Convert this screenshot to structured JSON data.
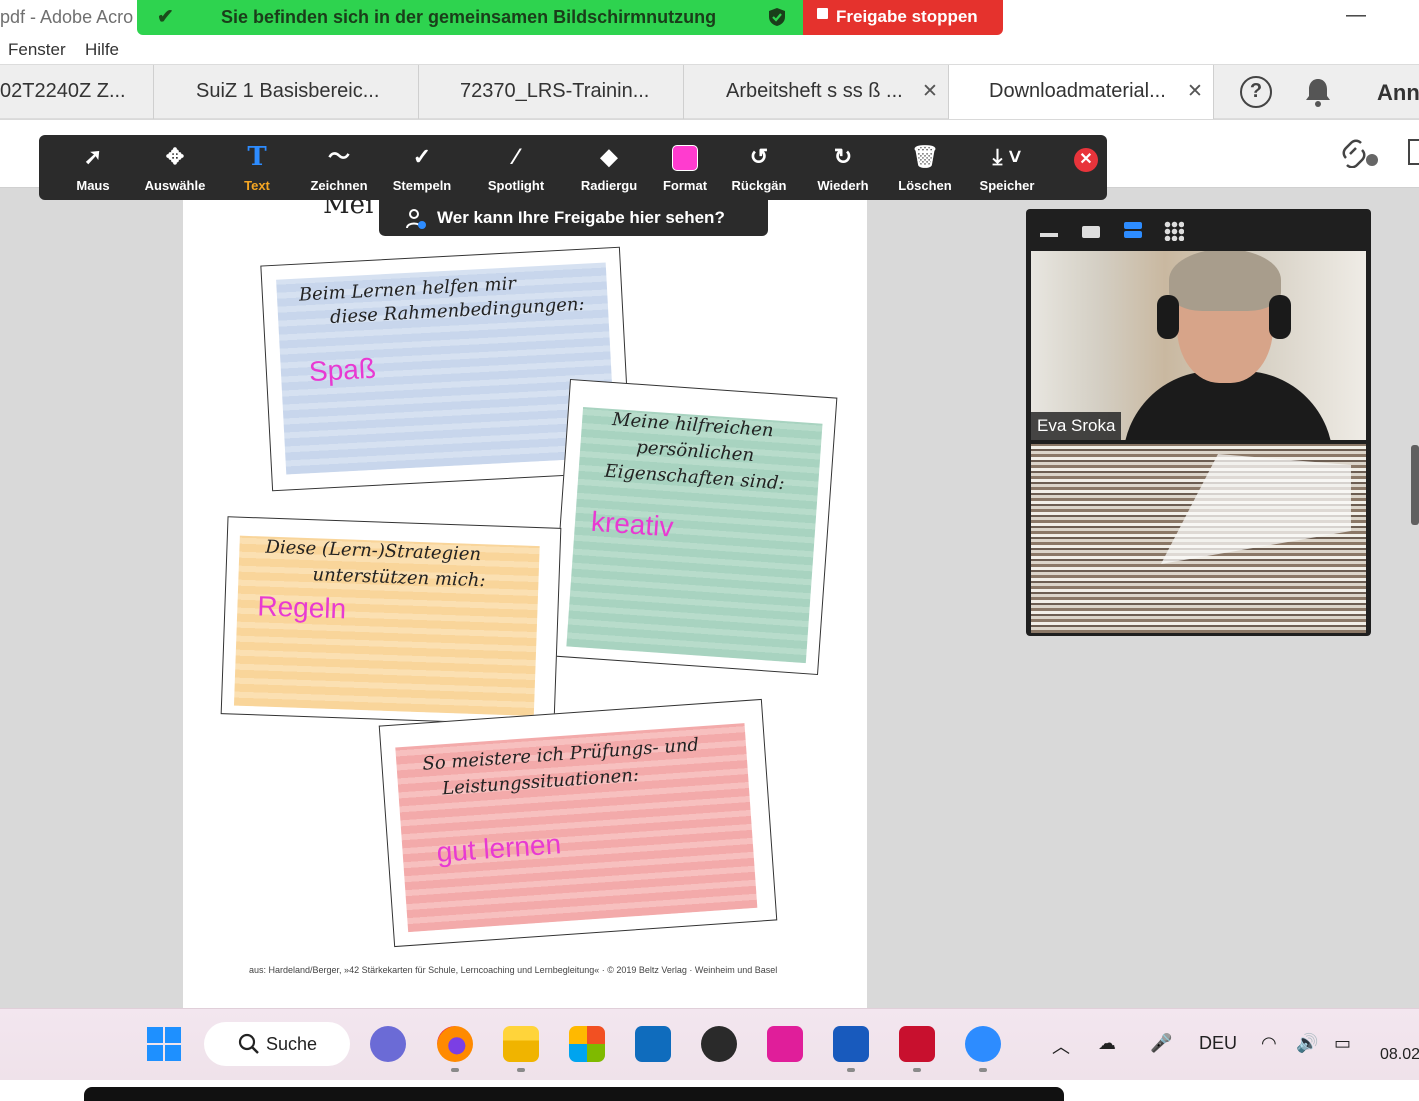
{
  "window": {
    "app_title": "pdf - Adobe Acro"
  },
  "share": {
    "banner_text": "Sie befinden sich in der gemeinsamen Bildschirmnutzung",
    "stop_label": "Freigabe stoppen",
    "who_sees_label": "Wer kann Ihre Freigabe hier sehen?"
  },
  "menu": {
    "items": [
      "Fenster",
      "Hilfe"
    ]
  },
  "tabs": [
    {
      "label": "02T2240Z Z...",
      "closable": false
    },
    {
      "label": "SuiZ 1 Basisbereic...",
      "closable": false
    },
    {
      "label": "72370_LRS-Trainin...",
      "closable": false
    },
    {
      "label": "Arbeitsheft s ss ß ...",
      "closable": true
    },
    {
      "label": "Downloadmaterial...",
      "closable": true,
      "active": true
    }
  ],
  "header": {
    "user_name": "Ann"
  },
  "annotation_tools": [
    {
      "label": "Maus",
      "icon": "cursor-icon"
    },
    {
      "label": "Auswähle",
      "icon": "move-icon"
    },
    {
      "label": "Text",
      "icon": "text-icon"
    },
    {
      "label": "Zeichnen",
      "icon": "draw-icon"
    },
    {
      "label": "Stempeln",
      "icon": "stamp-icon"
    },
    {
      "label": "Spotlight",
      "icon": "spotlight-icon"
    },
    {
      "label": "Radiergu",
      "icon": "eraser-icon"
    },
    {
      "label": "Format",
      "icon": "format-icon"
    },
    {
      "label": "Rückgän",
      "icon": "undo-icon"
    },
    {
      "label": "Wiederh",
      "icon": "redo-icon"
    },
    {
      "label": "Löschen",
      "icon": "trash-icon"
    },
    {
      "label": "Speicher",
      "icon": "save-icon"
    }
  ],
  "colors": {
    "format_swatch": "#ff3ccf",
    "answer_text": "#e83ad2",
    "share_green": "#2ed34f",
    "stop_red": "#e5322d"
  },
  "document": {
    "title_fragment": "Mei",
    "cards": [
      {
        "prompt_lines": [
          "Beim Lernen helfen mir",
          "diese Rahmenbedingungen:"
        ],
        "answer": "Spaß"
      },
      {
        "prompt_lines": [
          "Meine hilfreichen",
          "persönlichen",
          "Eigenschaften sind:"
        ],
        "answer": "kreativ"
      },
      {
        "prompt_lines": [
          "Diese (Lern-)Strategien",
          "unterstützen mich:"
        ],
        "answer": "Regeln"
      },
      {
        "prompt_lines": [
          "So meistere ich Prüfungs- und",
          "Leistungssituationen:"
        ],
        "answer": "gut lernen"
      }
    ],
    "footer": "aus: Hardeland/Berger, »42 Stärkekarten für Schule, Lerncoaching und Lernbegleitung« · © 2019 Beltz Verlag · Weinheim und Basel"
  },
  "video": {
    "participant_name": "Eva Sroka"
  },
  "taskbar": {
    "search_label": "Suche",
    "language": "DEU",
    "date_fragment": "08.02"
  }
}
